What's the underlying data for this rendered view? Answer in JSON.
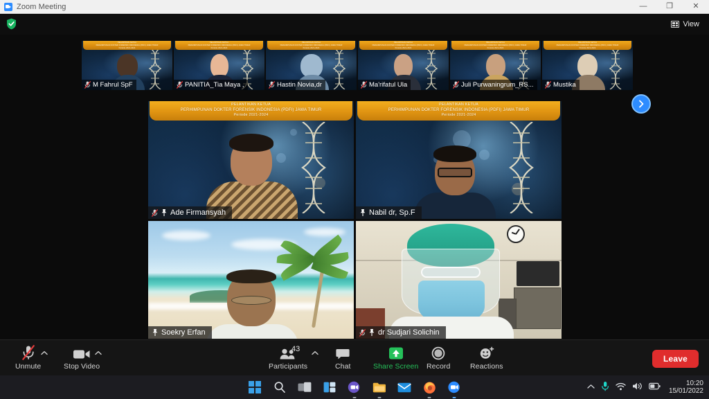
{
  "window": {
    "title": "Zoom Meeting",
    "minimize_label": "—",
    "maximize_label": "❐",
    "close_label": "✕"
  },
  "topbar": {
    "encryption_icon": "shield-check-icon",
    "view_label": "View",
    "view_icon": "view-layout-icon"
  },
  "stage": {
    "banner": {
      "line1": "PELANTIKAN KETUA",
      "line2": "PERHIMPUNAN DOKTER FORENSIK INDONESIA (PDFI) JAWA TIMUR",
      "line3": "Periode 2021-2024"
    },
    "next_page_icon": "chevron-right-icon",
    "thumbnails": [
      {
        "name": "M Fahrul SpF",
        "muted": true
      },
      {
        "name": "PANITIA_Tia Maya ,",
        "muted": true
      },
      {
        "name": "Hastin Novia,dr",
        "muted": true
      },
      {
        "name": "Ma'rifatul Ula",
        "muted": true
      },
      {
        "name": "Juli Purwaningrum_RS...",
        "muted": true
      },
      {
        "name": "Mustika",
        "muted": true
      }
    ],
    "tiles": [
      {
        "name": "Ade Firmansyah",
        "muted": true,
        "pinned": true,
        "background": "science-dna"
      },
      {
        "name": "Nabil dr, Sp.F",
        "muted": false,
        "pinned": true,
        "background": "science-dna"
      },
      {
        "name": "Soekry Erfan",
        "muted": false,
        "pinned": true,
        "background": "beach"
      },
      {
        "name": "dr Sudjari Solichin",
        "muted": true,
        "pinned": true,
        "background": "clinic"
      }
    ]
  },
  "toolbar": {
    "mute": {
      "label": "Unmute",
      "icon": "microphone-muted-icon",
      "has_caret": true
    },
    "video": {
      "label": "Stop Video",
      "icon": "video-camera-icon",
      "has_caret": true
    },
    "participants": {
      "label": "Participants",
      "count": "43",
      "icon": "people-icon",
      "has_caret": true
    },
    "chat": {
      "label": "Chat",
      "icon": "chat-bubble-icon"
    },
    "share": {
      "label": "Share Screen",
      "icon": "share-screen-up-arrow-icon",
      "color": "#25c15a"
    },
    "record": {
      "label": "Record",
      "icon": "record-circle-icon"
    },
    "reactions": {
      "label": "Reactions",
      "icon": "smiley-plus-icon"
    },
    "leave": {
      "label": "Leave",
      "color": "#e02d2d"
    }
  },
  "taskbar": {
    "icons": [
      "windows-start-icon",
      "search-icon",
      "task-view-icon",
      "widgets-icon",
      "teams-icon",
      "file-explorer-icon",
      "mail-icon",
      "firefox-icon",
      "zoom-icon"
    ],
    "tray": {
      "overflow_icon": "chevron-up-icon",
      "mic_icon": "microphone-icon",
      "wifi_icon": "wifi-icon",
      "volume_icon": "speaker-icon",
      "battery_icon": "battery-icon",
      "time": "10:20",
      "date": "15/01/2022"
    }
  }
}
